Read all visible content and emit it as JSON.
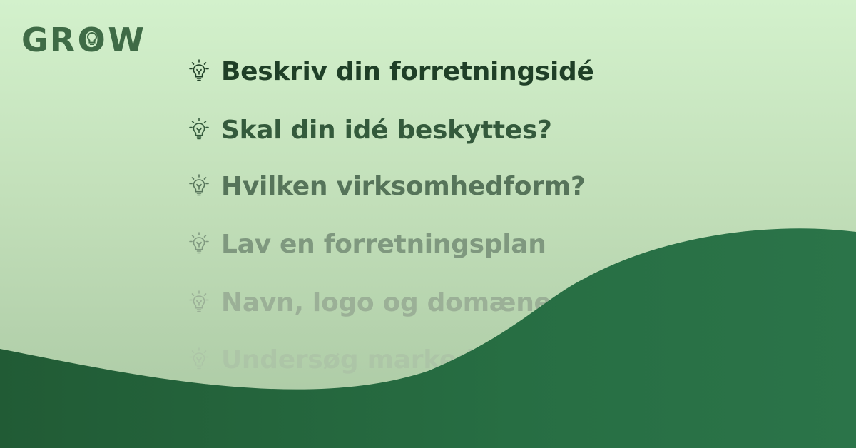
{
  "brand": {
    "logo": "GROW"
  },
  "list": {
    "icon": "lightbulb-icon",
    "items": [
      "Beskriv din forretningsidé",
      "Skal din idé beskyttes?",
      "Hvilken virksomhedform?",
      "Lav en forretningsplan",
      "Navn, logo og domæne",
      "Undersøg markedet"
    ]
  },
  "colors": {
    "background_top": "#d3f1cc",
    "wave_green": "#2a6d45",
    "logo_green": "#3f6b46",
    "text_dark": "#1f3f27"
  }
}
